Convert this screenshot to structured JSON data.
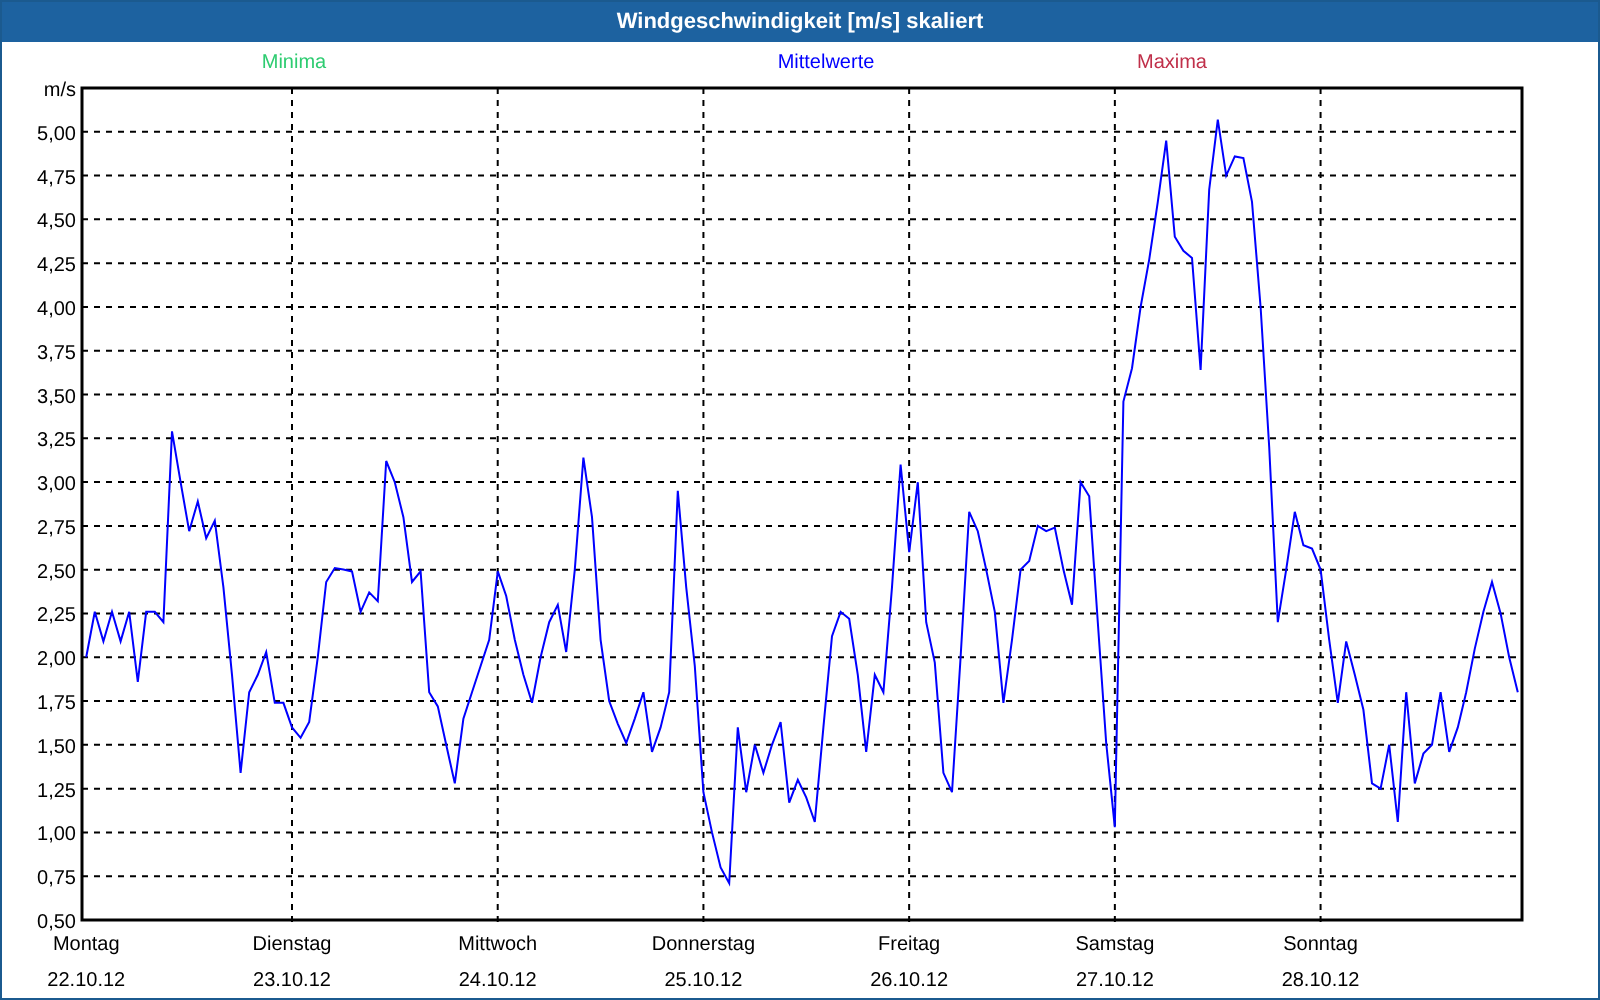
{
  "window": {
    "title": "Windgeschwindigkeit [m/s] skaliert"
  },
  "legend": [
    {
      "label": "Minima",
      "color": "#2ecc71"
    },
    {
      "label": "Maxima",
      "color": "#c0304a"
    }
  ],
  "x_dates": [
    "22.10.12",
    "23.10.12",
    "24.10.12",
    "25.10.12",
    "26.10.12",
    "27.10.12",
    "28.10.12"
  ],
  "chart_data": {
    "type": "line",
    "grid": true,
    "ylabel": "m/s",
    "ylim": [
      0.5,
      5.25
    ],
    "categories": [
      "Montag",
      null,
      null,
      null,
      null,
      null,
      null,
      null,
      null,
      null,
      null,
      null,
      null,
      null,
      null,
      null,
      null,
      null,
      null,
      null,
      null,
      null,
      null,
      null,
      "Dienstag",
      null,
      null,
      null,
      null,
      null,
      null,
      null,
      null,
      null,
      null,
      null,
      null,
      null,
      null,
      null,
      null,
      null,
      null,
      null,
      null,
      null,
      null,
      null,
      "Mittwoch",
      null,
      null,
      null,
      null,
      null,
      null,
      null,
      null,
      null,
      null,
      null,
      null,
      null,
      null,
      null,
      null,
      null,
      null,
      null,
      null,
      null,
      null,
      null,
      "Donnerstag",
      null,
      null,
      null,
      null,
      null,
      null,
      null,
      null,
      null,
      null,
      null,
      null,
      null,
      null,
      null,
      null,
      null,
      null,
      null,
      null,
      null,
      null,
      null,
      "Freitag",
      null,
      null,
      null,
      null,
      null,
      null,
      null,
      null,
      null,
      null,
      null,
      null,
      null,
      null,
      null,
      null,
      null,
      null,
      null,
      null,
      null,
      null,
      null,
      "Samstag",
      null,
      null,
      null,
      null,
      null,
      null,
      null,
      null,
      null,
      null,
      null,
      null,
      null,
      null,
      null,
      null,
      null,
      null,
      null,
      null,
      null,
      null,
      null,
      "Sonntag",
      null,
      null,
      null,
      null,
      null,
      null,
      null,
      null,
      null,
      null,
      null,
      null,
      null,
      null,
      null,
      null,
      null,
      null,
      null,
      null,
      null,
      null,
      null
    ],
    "yticks": [
      {
        "value": 0.5,
        "label": "0,50"
      },
      {
        "value": 0.75,
        "label": "0,75"
      },
      {
        "value": 1,
        "label": "1,00"
      },
      {
        "value": 1.25,
        "label": "1,25"
      },
      {
        "value": 1.5,
        "label": "1,50"
      },
      {
        "value": 1.75,
        "label": "1,75"
      },
      {
        "value": 2,
        "label": "2,00"
      },
      {
        "value": 2.25,
        "label": "2,25"
      },
      {
        "value": 2.5,
        "label": "2,50"
      },
      {
        "value": 2.75,
        "label": "2,75"
      },
      {
        "value": 3,
        "label": "3,00"
      },
      {
        "value": 3.25,
        "label": "3,25"
      },
      {
        "value": 3.5,
        "label": "3,50"
      },
      {
        "value": 3.75,
        "label": "3,75"
      },
      {
        "value": 4,
        "label": "4,00"
      },
      {
        "value": 4.25,
        "label": "4,25"
      },
      {
        "value": 4.5,
        "label": "4,50"
      },
      {
        "value": 4.75,
        "label": "4,75"
      },
      {
        "value": 5,
        "label": "5,00"
      }
    ],
    "series": [
      {
        "name": "Mittelwerte",
        "color": "#0000ff",
        "values": [
          2.0,
          2.26,
          2.09,
          2.26,
          2.09,
          2.26,
          1.86,
          2.26,
          2.26,
          2.2,
          3.29,
          3.0,
          2.72,
          2.89,
          2.68,
          2.78,
          2.4,
          1.9,
          1.34,
          1.8,
          1.9,
          2.03,
          1.74,
          1.74,
          1.6,
          1.54,
          1.63,
          2.0,
          2.43,
          2.51,
          2.5,
          2.49,
          2.26,
          2.37,
          2.32,
          3.12,
          3.0,
          2.8,
          2.43,
          2.49,
          1.8,
          1.72,
          1.5,
          1.28,
          1.65,
          1.8,
          1.95,
          2.1,
          2.49,
          2.35,
          2.1,
          1.9,
          1.74,
          2.0,
          2.2,
          2.3,
          2.03,
          2.5,
          3.14,
          2.8,
          2.1,
          1.75,
          1.62,
          1.51,
          1.65,
          1.8,
          1.46,
          1.6,
          1.8,
          2.95,
          2.4,
          1.95,
          1.23,
          1.0,
          0.8,
          0.71,
          1.6,
          1.23,
          1.5,
          1.34,
          1.5,
          1.63,
          1.17,
          1.3,
          1.2,
          1.06,
          1.6,
          2.12,
          2.26,
          2.22,
          1.9,
          1.46,
          1.9,
          1.8,
          2.4,
          3.1,
          2.6,
          3.0,
          2.2,
          1.97,
          1.34,
          1.23,
          2.0,
          2.83,
          2.72,
          2.5,
          2.26,
          1.74,
          2.1,
          2.5,
          2.55,
          2.75,
          2.72,
          2.74,
          2.5,
          2.3,
          3.0,
          2.92,
          2.2,
          1.51,
          1.03,
          3.46,
          3.65,
          4.0,
          4.27,
          4.6,
          4.95,
          4.4,
          4.32,
          4.28,
          3.64,
          4.67,
          5.07,
          4.75,
          4.86,
          4.85,
          4.6,
          4.0,
          3.2,
          2.2,
          2.5,
          2.83,
          2.64,
          2.62,
          2.5,
          2.1,
          1.74,
          2.09,
          1.9,
          1.7,
          1.28,
          1.25,
          1.5,
          1.06,
          1.8,
          1.28,
          1.45,
          1.5,
          1.8,
          1.46,
          1.6,
          1.8,
          2.05,
          2.26,
          2.43,
          2.25,
          2.0,
          1.8
        ]
      }
    ]
  }
}
